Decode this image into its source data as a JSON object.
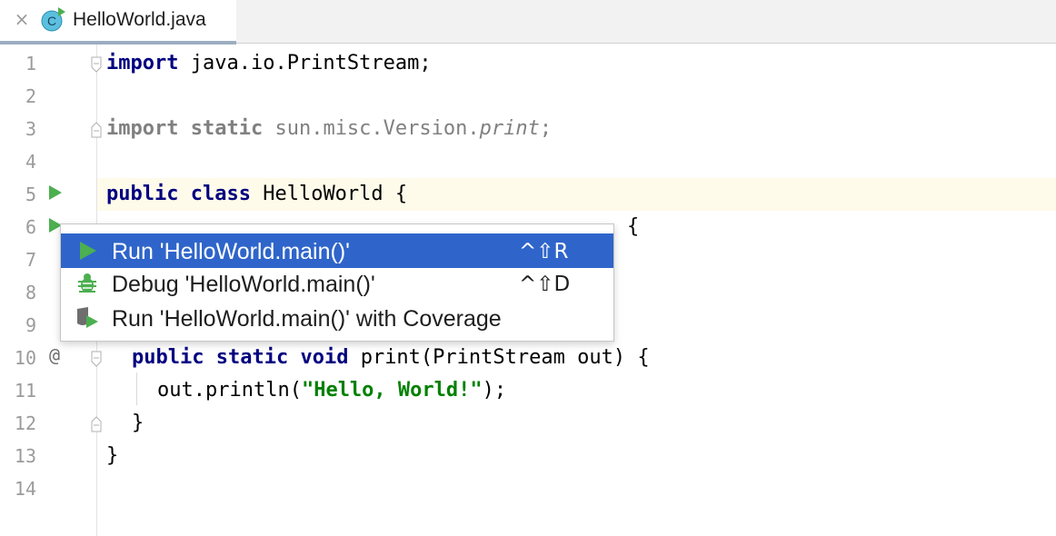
{
  "tab": {
    "title": "HelloWorld.java",
    "close_glyph": "×",
    "icon": "java-class-runnable-icon",
    "icon_letter": "C"
  },
  "editor": {
    "line_numbers": [
      "1",
      "2",
      "3",
      "4",
      "5",
      "6",
      "7",
      "8",
      "9",
      "10",
      "11",
      "12",
      "13",
      "14"
    ],
    "lines": {
      "l1": {
        "kw": "import",
        "rest": " java.io.PrintStream;"
      },
      "l3": {
        "kw1": "import",
        "sp": " ",
        "kw2": "static",
        "pkg": " sun.misc.Version.",
        "method": "print",
        "semi": ";"
      },
      "l5": {
        "kw1": "public",
        "kw2": "class",
        "rest": " HelloWorld {"
      },
      "l6_tail": "{",
      "l10": {
        "kw1": "public",
        "kw2": "static",
        "kw3": "void",
        "rest": " print(PrintStream out) {"
      },
      "l11": {
        "pre": "out.println(",
        "str": "\"Hello, World!\"",
        "post": ");"
      },
      "l12": "}",
      "l13": "}"
    },
    "gutter_icons": [
      "run-arrow-icon",
      "run-arrow-icon",
      "implemented-at-icon"
    ],
    "colors": {
      "keyword": "#000080",
      "string": "#008000",
      "run_green": "#4caf50",
      "selection": "#2f65ca"
    }
  },
  "popup": {
    "items": [
      {
        "icon": "run-icon",
        "label": "Run 'HelloWorld.main()'",
        "shortcut": "^⇧R",
        "selected": true
      },
      {
        "icon": "debug-icon",
        "label": "Debug 'HelloWorld.main()'",
        "shortcut": "^⇧D",
        "selected": false
      },
      {
        "icon": "coverage-icon",
        "label": "Run 'HelloWorld.main()' with Coverage",
        "shortcut": "",
        "selected": false
      }
    ]
  }
}
